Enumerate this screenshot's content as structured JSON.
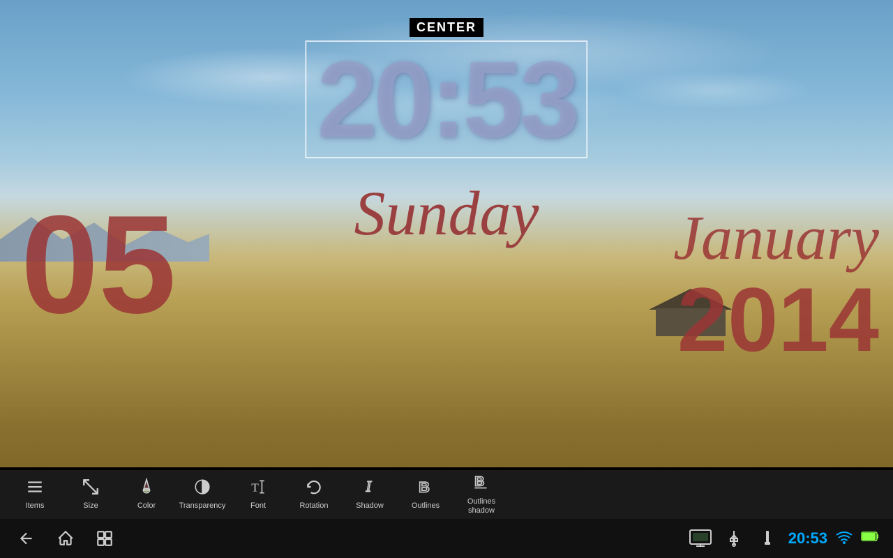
{
  "header": {
    "center_label": "CENTER"
  },
  "clock": {
    "time": "20:53",
    "day": "Sunday",
    "day_number": "05",
    "month": "January",
    "year": "2014"
  },
  "toolbar": {
    "items": [
      {
        "id": "items",
        "label": "Items",
        "icon": "≡"
      },
      {
        "id": "size",
        "label": "Size",
        "icon": "⤡"
      },
      {
        "id": "color",
        "label": "Color",
        "icon": "✎"
      },
      {
        "id": "transparency",
        "label": "Transparency",
        "icon": "◑"
      },
      {
        "id": "font",
        "label": "Font",
        "icon": "T↕"
      },
      {
        "id": "rotation",
        "label": "Rotation",
        "icon": "↺"
      },
      {
        "id": "shadow",
        "label": "Shadow",
        "icon": "I"
      },
      {
        "id": "outlines",
        "label": "Outlines",
        "icon": "B"
      },
      {
        "id": "outlines-shadow",
        "label": "Outlines shadow",
        "icon": "B̲"
      }
    ]
  },
  "status_bar": {
    "time": "20:53",
    "nav": {
      "back": "←",
      "home": "⌂",
      "recents": "▣"
    }
  }
}
